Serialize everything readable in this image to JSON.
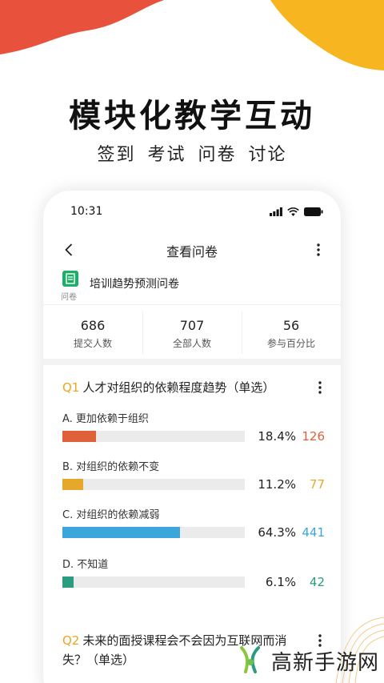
{
  "hero": {
    "title": "模块化教学互动",
    "subtitle": "签到 考试 问卷 讨论"
  },
  "status_bar": {
    "time": "10:31"
  },
  "nav": {
    "title": "查看问卷"
  },
  "survey": {
    "icon_label": "问卷",
    "name": "培训趋势预测问卷"
  },
  "stats": [
    {
      "value": "686",
      "label": "提交人数"
    },
    {
      "value": "707",
      "label": "全部人数"
    },
    {
      "value": "56",
      "label": "参与百分比"
    }
  ],
  "questions": [
    {
      "number": "Q1",
      "title": "人才对组织的依赖程度趋势（单选）",
      "options": [
        {
          "label": "A. 更加依赖于组织",
          "percent": "18.4%",
          "fraction": 0.184,
          "count": "126",
          "color": "#e0603a"
        },
        {
          "label": "B. 对组织的依赖不变",
          "percent": "11.2%",
          "fraction": 0.112,
          "count": "77",
          "color": "#e6a82a"
        },
        {
          "label": "C. 对组织的依赖减弱",
          "percent": "64.3%",
          "fraction": 0.643,
          "count": "441",
          "color": "#3aa6dc"
        },
        {
          "label": "D. 不知道",
          "percent": "6.1%",
          "fraction": 0.061,
          "count": "42",
          "color": "#2a9d80"
        }
      ]
    },
    {
      "number": "Q2",
      "title": "未来的面授课程会不会因为互联网而消失？（单选）"
    }
  ],
  "watermark": {
    "text": "高新手游网"
  },
  "colors": {
    "accent_orange": "#f0a320",
    "blob_red": "#e8523c",
    "blob_yellow": "#f7b51f",
    "icon_green": "#1fae6a"
  }
}
